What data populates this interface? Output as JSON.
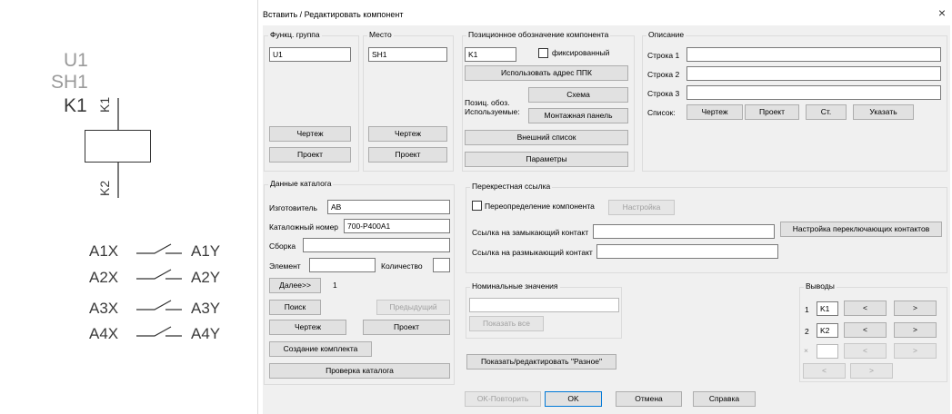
{
  "schematic": {
    "func_group": "U1",
    "location": "SH1",
    "tag": "K1",
    "pin_top": "K1",
    "pin_bottom": "K2",
    "contacts": [
      {
        "left": "A1X",
        "right": "A1Y"
      },
      {
        "left": "A2X",
        "right": "A2Y"
      },
      {
        "left": "A3X",
        "right": "A3Y"
      },
      {
        "left": "A4X",
        "right": "A4Y"
      }
    ]
  },
  "dialog": {
    "title": "Вставить / Редактировать компонент",
    "close": "×"
  },
  "func_group": {
    "legend": "Функц. группа",
    "value": "U1",
    "drawing_btn": "Чертеж",
    "project_btn": "Проект"
  },
  "location": {
    "legend": "Место",
    "value": "SH1",
    "drawing_btn": "Чертеж",
    "project_btn": "Проект"
  },
  "tag": {
    "legend": "Позиционное обозначение компонента",
    "value": "K1",
    "fixed_label": "фиксированный",
    "use_plc_btn": "Использовать адрес ППК",
    "used_label_1": "Позиц. обоз.",
    "used_label_2": "Используемые:",
    "schema_btn": "Схема",
    "panel_btn": "Монтажная панель",
    "external_btn": "Внешний список",
    "options_btn": "Параметры"
  },
  "description": {
    "legend": "Описание",
    "line1_label": "Строка 1",
    "line2_label": "Строка 2",
    "line3_label": "Строка 3",
    "list_label": "Список:",
    "drawing_btn": "Чертеж",
    "project_btn": "Проект",
    "std_btn": "Ст.",
    "pick_btn": "Указать"
  },
  "catalog": {
    "legend": "Данные каталога",
    "manufacturer_label": "Изготовитель",
    "manufacturer": "AB",
    "catalog_label": "Каталожный номер",
    "catalog_number": "700-P400A1",
    "assembly_label": "Сборка",
    "item_label": "Элемент",
    "count_label": "Количество",
    "next_btn": "Далее>>",
    "next_count": "1",
    "search_btn": "Поиск",
    "prev_btn": "Предыдущий",
    "drawing_btn": "Чертеж",
    "project_btn": "Проект",
    "kit_btn": "Создание комплекта",
    "check_btn": "Проверка каталога"
  },
  "xref": {
    "legend": "Перекрестная ссылка",
    "override_label": "Переопределение компонента",
    "setup_btn": "Настройка",
    "no_label": "Ссылка на замыкающий контакт",
    "nc_label": "Ссылка на размыкающий контакт",
    "switch_btn": "Настройка переключающих контактов"
  },
  "ratings": {
    "legend": "Номинальные значения",
    "show_all_btn": "Показать все"
  },
  "misc_btn": "Показать/редактировать \"Разное\"",
  "pins": {
    "legend": "Выводы",
    "row1_num": "1",
    "row1_value": "K1",
    "row2_num": "2",
    "row2_value": "K2",
    "row3_num": "×",
    "prev": "<",
    "next": ">"
  },
  "footer": {
    "ok_repeat": "OK-Повторить",
    "ok": "OK",
    "cancel": "Отмена",
    "help": "Справка"
  }
}
